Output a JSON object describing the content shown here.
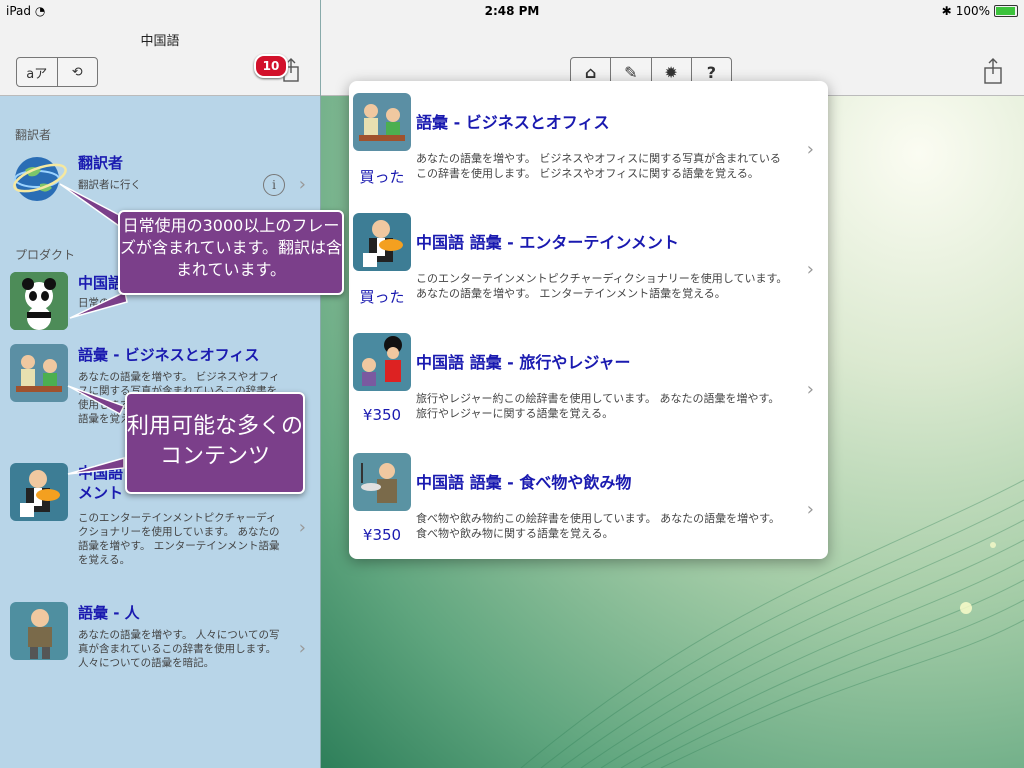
{
  "status_bar": {
    "device": "iPad",
    "time": "2:48 PM",
    "battery": "100%"
  },
  "sidebar": {
    "title": "中国語",
    "seg_left": "aア",
    "seg_right": "⟲",
    "badge_count": "10",
    "section_translator": "翻訳者",
    "translator": {
      "title": "翻訳者",
      "subtitle": "翻訳者に行く"
    },
    "section_products": "プロダクト",
    "products": [
      {
        "title": "中国語",
        "desc": "日常の"
      },
      {
        "title": "語彙 - ビジネスとオフィス",
        "desc": "あなたの語彙を増やす。 ビジネスやオフィスに関する写真が含まれているこの辞書を使用します。 ビジネスやオフィスに関する語彙を覚える。"
      },
      {
        "title": "中国語 語彙 - エンターテインメント",
        "desc": "このエンターテインメントピクチャーディクショナリーを使用しています。 あなたの語彙を増やす。 エンターテインメント語彙を覚える。"
      },
      {
        "title": "語彙 - 人",
        "desc": "あなたの語彙を増やす。 人々についての写真が含まれているこの辞書を使用します。 人々についての語彙を暗記。"
      }
    ]
  },
  "toolbar": {
    "icons": [
      "home-icon",
      "translate-icon",
      "settings-icon",
      "help-icon"
    ],
    "help_label": "?"
  },
  "popover": {
    "items": [
      {
        "title": "語彙 - ビジネスとオフィス",
        "price": "買った",
        "desc": "あなたの語彙を増やす。 ビジネスやオフィスに関する写真が含まれているこの辞書を使用します。 ビジネスやオフィスに関する語彙を覚える。"
      },
      {
        "title": "中国語 語彙 - エンターテインメント",
        "price": "買った",
        "desc": "このエンターテインメントピクチャーディクショナリーを使用しています。 あなたの語彙を増やす。 エンターテインメント語彙を覚える。"
      },
      {
        "title": "中国語 語彙 - 旅行やレジャー",
        "price": "¥350",
        "desc": "旅行やレジャー約この絵辞書を使用しています。 あなたの語彙を増やす。 旅行やレジャーに関する語彙を覚える。"
      },
      {
        "title": "中国語 語彙 - 食べ物や飲み物",
        "price": "¥350",
        "desc": "食べ物や飲み物約この絵辞書を使用しています。 あなたの語彙を増やす。 食べ物や飲み物に関する語彙を覚える。"
      }
    ]
  },
  "callouts": {
    "phrases": "日常使用の3000以上のフレーズが含まれています。翻訳は含まれています。",
    "content": "利用可能な多くのコンテンツ"
  },
  "colors": {
    "accent": "#1a1ab0",
    "callout": "#7b3f8a",
    "badge": "#d2112b",
    "sidebar_bg": "#b8d5e8"
  }
}
